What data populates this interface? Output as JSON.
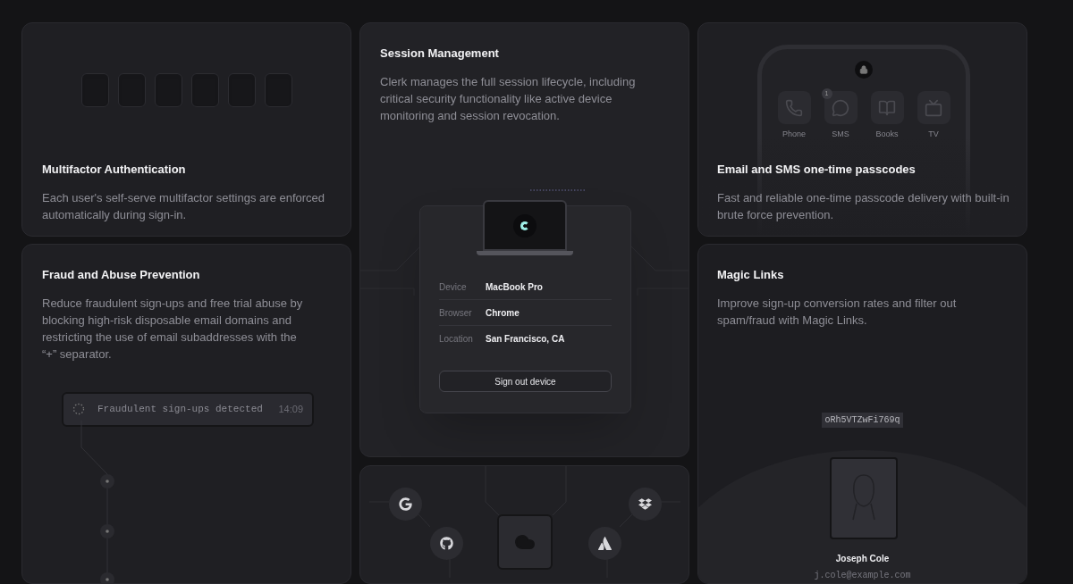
{
  "mfa": {
    "title": "Multifactor Authentication",
    "description": "Each user's self-serve multifactor settings are enforced automatically during sign-in."
  },
  "fraud": {
    "title": "Fraud and Abuse Prevention",
    "description": "Reduce fraudulent sign-ups and free trial abuse by blocking high-risk disposable email domains and restricting the use of email subaddresses with the “+” separator.",
    "alert": {
      "message": "Fraudulent sign-ups detected",
      "time": "14:09"
    }
  },
  "session": {
    "title": "Session Management",
    "description": "Clerk manages the full session lifecycle, including critical security functionality like active device monitoring and session revocation.",
    "rows": [
      {
        "label": "Device",
        "value": "MacBook Pro"
      },
      {
        "label": "Browser",
        "value": "Chrome"
      },
      {
        "label": "Location",
        "value": "San Francisco, CA"
      }
    ],
    "button": "Sign out device"
  },
  "sso": {
    "providers": [
      {
        "kind": "google"
      },
      {
        "kind": "github"
      },
      {
        "kind": "atlassian"
      },
      {
        "kind": "dropbox"
      }
    ]
  },
  "otp": {
    "title": "Email and SMS one-time passcodes",
    "description": "Fast and reliable one-time passcode delivery with built-in brute force prevention.",
    "apps": [
      {
        "kind": "phone",
        "label": "Phone"
      },
      {
        "kind": "sms",
        "label": "SMS",
        "badge": "1"
      },
      {
        "kind": "books",
        "label": "Books"
      },
      {
        "kind": "tv",
        "label": "TV"
      }
    ]
  },
  "magic": {
    "title": "Magic Links",
    "description": "Improve sign-up conversion rates and filter out spam/fraud with Magic Links.",
    "token": "oRh5VTZwFi769q",
    "user": {
      "name": "Joseph Cole",
      "email": "j.cole@example.com"
    }
  }
}
